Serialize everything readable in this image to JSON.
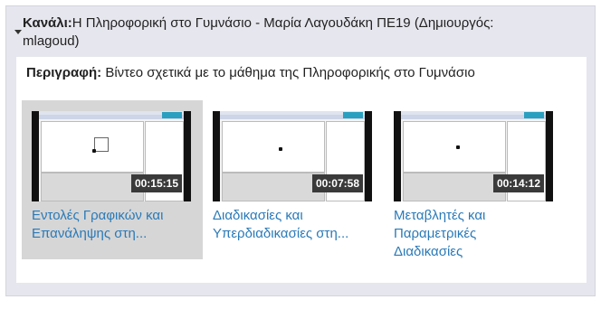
{
  "channel": {
    "label": "Κανάλι:",
    "name": "Η Πληροφορική στο Γυμνάσιο - Μαρία Λαγουδάκη ΠΕ19",
    "creator_prefix": "(Δημιουργός:",
    "creator": "mlagoud)"
  },
  "description": {
    "label": "Περιγραφή:",
    "text": "Βίντεο σχετικά με το μάθημα της Πληροφορικής στο Γυμνάσιο"
  },
  "videos": [
    {
      "title_line1": "Εντολές Γραφικών και",
      "title_line2": "Επανάληψης στη...",
      "title_line3": "",
      "duration": "00:15:15",
      "selected": true
    },
    {
      "title_line1": "Διαδικασίες και",
      "title_line2": "Υπερδιαδικασίες στη...",
      "title_line3": "",
      "duration": "00:07:58",
      "selected": false
    },
    {
      "title_line1": "Μεταβλητές και",
      "title_line2": "Παραμετρικές",
      "title_line3": "Διαδικασίες",
      "duration": "00:14:12",
      "selected": false
    }
  ],
  "colors": {
    "link": "#2a7ab8",
    "panel_bg": "#e6e6ee",
    "duration_bg": "#3a3a3a",
    "selected_bg": "#d6d6d6"
  }
}
